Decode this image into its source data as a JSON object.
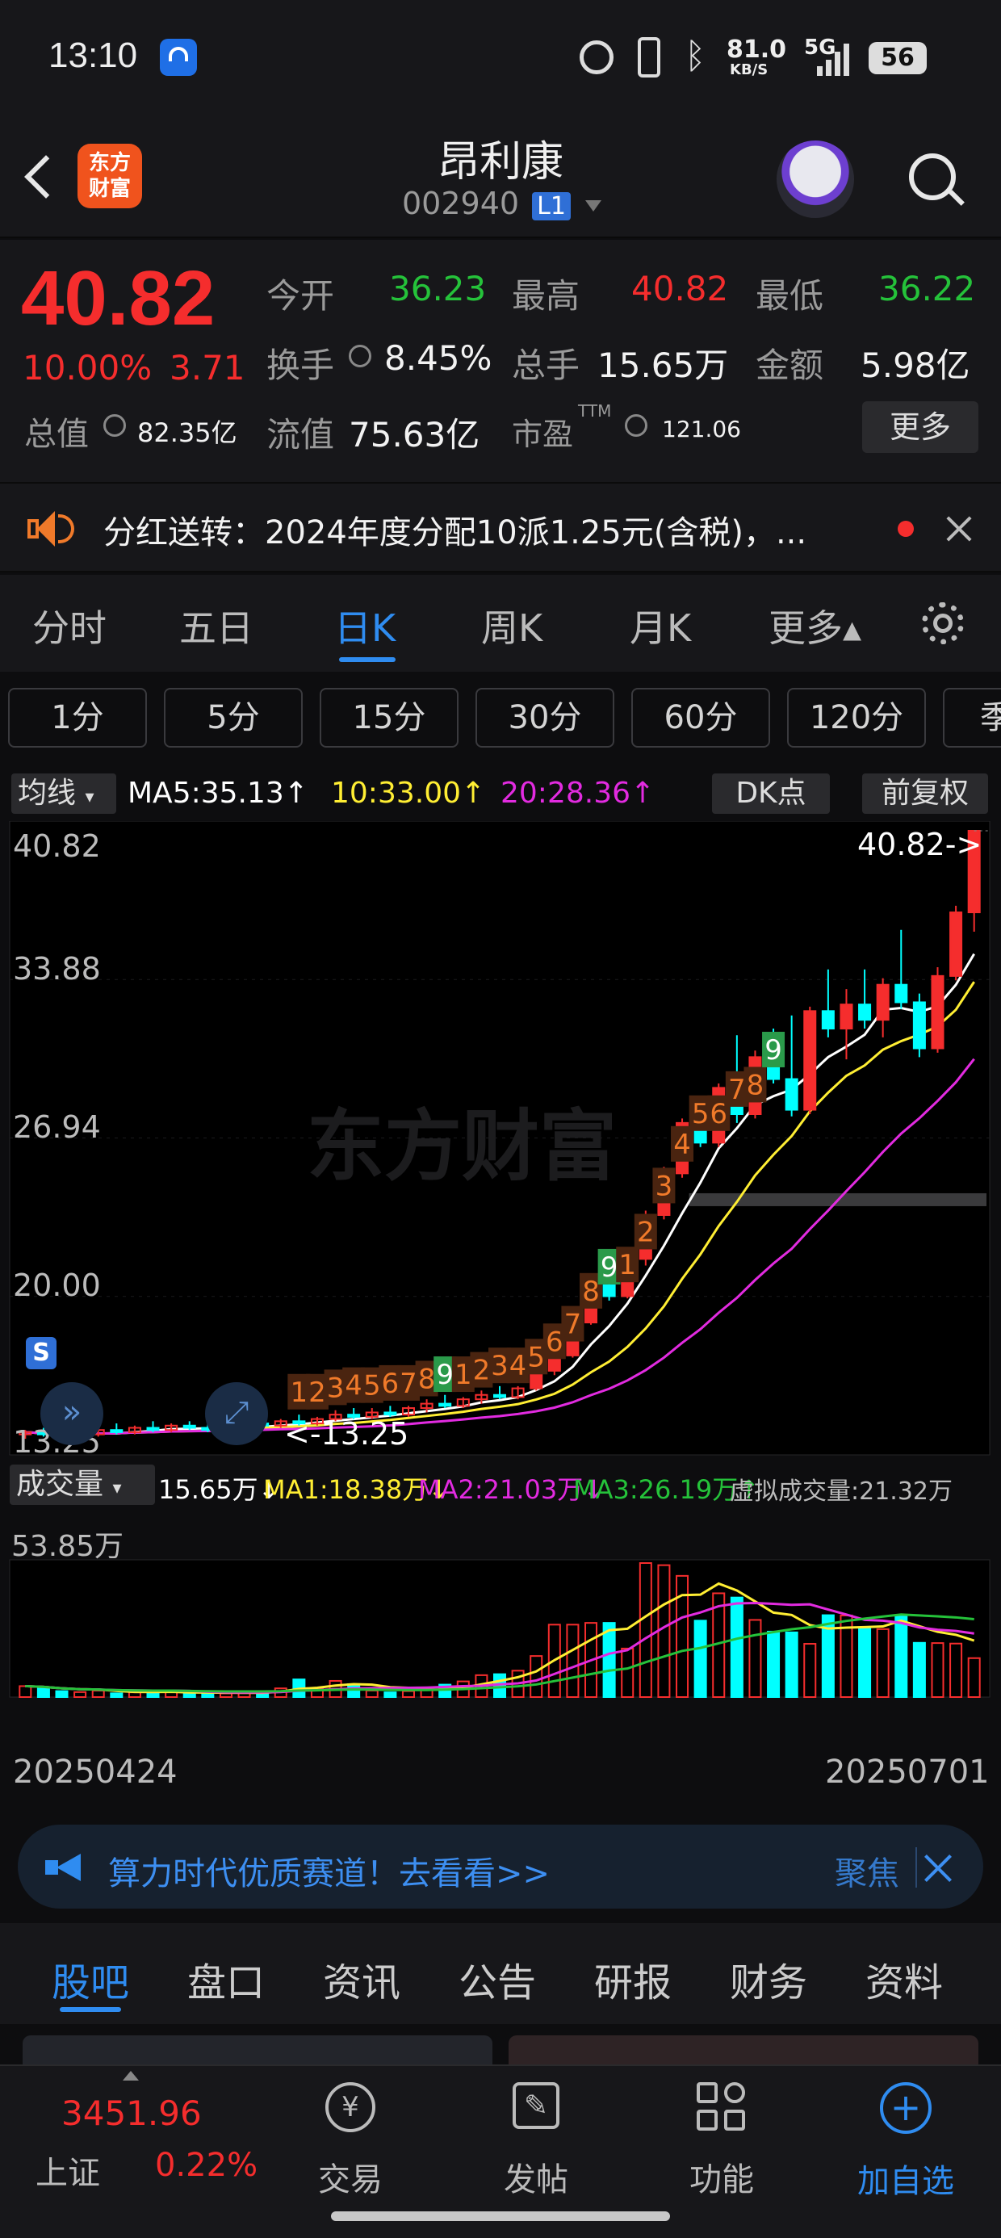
{
  "status_bar": {
    "time": "13:10",
    "network_speed": "81.0",
    "speed_unit": "KB/S",
    "signal": "5G",
    "battery": "56"
  },
  "header": {
    "title": "昂利康",
    "stock_code": "002940",
    "level_badge": "L1",
    "logo_text_1": "东方",
    "logo_text_2": "财富"
  },
  "quote": {
    "price": "40.82",
    "change_pct": "10.00%",
    "change_abs": "3.71",
    "open_label": "今开",
    "open": "36.23",
    "high_label": "最高",
    "high": "40.82",
    "low_label": "最低",
    "low": "36.22",
    "turnover_label": "换手",
    "turnover": "8.45%",
    "volume_label": "总手",
    "volume": "15.65万",
    "amount_label": "金额",
    "amount": "5.98亿",
    "mcap_label": "总值",
    "mcap": "82.35亿",
    "float_label": "流值",
    "float_cap": "75.63亿",
    "pe_label": "市盈",
    "pe_sup": "TTM",
    "pe": "121.06",
    "more_button": "更多"
  },
  "notice": {
    "text": "分红送转：2024年度分配10派1.25元(含税)，..."
  },
  "kline_tabs": [
    "分时",
    "五日",
    "日K",
    "周K",
    "月K",
    "更多▴"
  ],
  "active_tab_index": 2,
  "period_tabs": [
    "1分",
    "5分",
    "15分",
    "30分",
    "60分",
    "120分",
    "季"
  ],
  "ma_bar": {
    "selector": "均线",
    "ma5": "MA5:35.13↑",
    "ma10": "10:33.00↑",
    "ma20": "20:28.36↑",
    "dk_button": "DK点",
    "fq_button": "前复权"
  },
  "price_axis": {
    "labels": [
      "40.82",
      "33.88",
      "26.94",
      "20.00",
      "13.25"
    ],
    "last_price_label": "40.82->",
    "low_marker": "<-13.25",
    "watermark": "东方财富"
  },
  "volume_bar": {
    "selector": "成交量",
    "vol": "15.65万↓",
    "ma1": "MA1:18.38万↓",
    "ma2": "MA2:21.03万↓",
    "ma3": "MA3:26.19万↑",
    "virtual": "虚拟成交量:21.32万",
    "max_label": "53.85万"
  },
  "date_axis": {
    "start": "20250424",
    "end": "20250701"
  },
  "banner": {
    "text": "算力时代优质赛道！去看看>>",
    "right_text": "聚焦"
  },
  "bottom_tabs": [
    "股吧",
    "盘口",
    "资讯",
    "公告",
    "研报",
    "财务",
    "资料"
  ],
  "bottom_nav": {
    "index_name": "上证",
    "index_value": "3451.96",
    "index_change": "0.22%",
    "items": [
      "交易",
      "发帖",
      "功能",
      "加自选"
    ]
  },
  "colors": {
    "up": "#f52d2d",
    "down": "#25c23a",
    "accent": "#2f8cf0",
    "ma5": "#ffffff",
    "ma10": "#ffee33",
    "ma20": "#e22be0",
    "cyan": "#00ffff"
  },
  "chart_data": {
    "type": "candlestick",
    "date_range": [
      "20250424",
      "20250701"
    ],
    "ylim": [
      13.25,
      40.82
    ],
    "ohlc": [
      [
        13.3,
        13.5,
        13.1,
        13.4
      ],
      [
        13.4,
        13.6,
        13.2,
        13.3
      ],
      [
        13.3,
        13.5,
        13.1,
        13.2
      ],
      [
        13.2,
        13.4,
        13.0,
        13.3
      ],
      [
        13.3,
        13.6,
        13.2,
        13.5
      ],
      [
        13.5,
        13.8,
        13.3,
        13.4
      ],
      [
        13.4,
        13.7,
        13.3,
        13.6
      ],
      [
        13.6,
        13.9,
        13.4,
        13.5
      ],
      [
        13.5,
        13.8,
        13.4,
        13.7
      ],
      [
        13.7,
        13.9,
        13.5,
        13.6
      ],
      [
        13.6,
        13.8,
        13.4,
        13.5
      ],
      [
        13.5,
        13.7,
        13.3,
        13.6
      ],
      [
        13.6,
        13.9,
        13.5,
        13.8
      ],
      [
        13.8,
        14.1,
        13.6,
        13.7
      ],
      [
        13.7,
        14.0,
        13.6,
        13.9
      ],
      [
        13.9,
        14.2,
        13.7,
        13.8
      ],
      [
        13.8,
        14.1,
        13.7,
        14.0
      ],
      [
        14.0,
        14.4,
        13.9,
        14.2
      ],
      [
        14.2,
        14.5,
        14.0,
        14.1
      ],
      [
        14.1,
        14.5,
        14.0,
        14.3
      ],
      [
        14.3,
        14.6,
        14.1,
        14.2
      ],
      [
        14.2,
        14.6,
        14.1,
        14.5
      ],
      [
        14.5,
        14.9,
        14.3,
        14.7
      ],
      [
        14.7,
        15.1,
        14.5,
        14.6
      ],
      [
        14.6,
        15.0,
        14.5,
        14.9
      ],
      [
        14.9,
        15.3,
        14.7,
        15.1
      ],
      [
        15.1,
        15.5,
        14.9,
        15.0
      ],
      [
        15.0,
        15.5,
        14.9,
        15.4
      ],
      [
        15.4,
        16.3,
        15.3,
        16.2
      ],
      [
        16.2,
        17.1,
        16.0,
        16.9
      ],
      [
        16.9,
        18.5,
        16.8,
        18.4
      ],
      [
        18.4,
        20.2,
        18.3,
        20.1
      ],
      [
        20.1,
        20.5,
        19.4,
        19.6
      ],
      [
        19.6,
        21.5,
        19.5,
        21.3
      ],
      [
        21.3,
        23.5,
        21.0,
        23.3
      ],
      [
        23.3,
        25.5,
        23.1,
        25.2
      ],
      [
        25.2,
        27.7,
        25.0,
        27.5
      ],
      [
        27.5,
        27.9,
        26.4,
        26.6
      ],
      [
        26.6,
        29.3,
        26.4,
        29.1
      ],
      [
        29.1,
        31.5,
        27.5,
        27.9
      ],
      [
        27.9,
        30.8,
        27.7,
        30.5
      ],
      [
        30.5,
        31.8,
        29.3,
        29.5
      ],
      [
        29.5,
        32.4,
        27.8,
        28.1
      ],
      [
        28.1,
        32.8,
        27.9,
        32.6
      ],
      [
        32.6,
        34.5,
        31.4,
        31.8
      ],
      [
        31.8,
        33.6,
        30.4,
        32.9
      ],
      [
        32.9,
        34.5,
        31.8,
        32.2
      ],
      [
        32.2,
        34.1,
        31.4,
        33.8
      ],
      [
        33.8,
        36.3,
        32.7,
        33.0
      ],
      [
        33.0,
        33.4,
        30.5,
        30.9
      ],
      [
        30.9,
        34.6,
        30.7,
        34.2
      ],
      [
        34.2,
        37.4,
        34.0,
        37.1
      ],
      [
        37.1,
        40.82,
        36.22,
        40.82
      ]
    ],
    "volume": [
      4.4,
      3.8,
      2.4,
      2.0,
      2.6,
      1.5,
      1.9,
      2.2,
      2.4,
      1.4,
      1.3,
      1.5,
      2.0,
      2.4,
      3.5,
      7.1,
      3.6,
      6.5,
      5.2,
      2.6,
      1.9,
      2.4,
      3.1,
      5.0,
      6.3,
      8.8,
      9.2,
      10.6,
      16.5,
      29.1,
      29.1,
      29.8,
      29.8,
      19.5,
      53.85,
      53.0,
      48.7,
      30.7,
      41.7,
      40.0,
      31.0,
      26.3,
      26.0,
      21.4,
      32.9,
      32.8,
      27.5,
      27.3,
      32.8,
      21.8,
      21.7,
      21.5,
      15.65
    ]
  }
}
